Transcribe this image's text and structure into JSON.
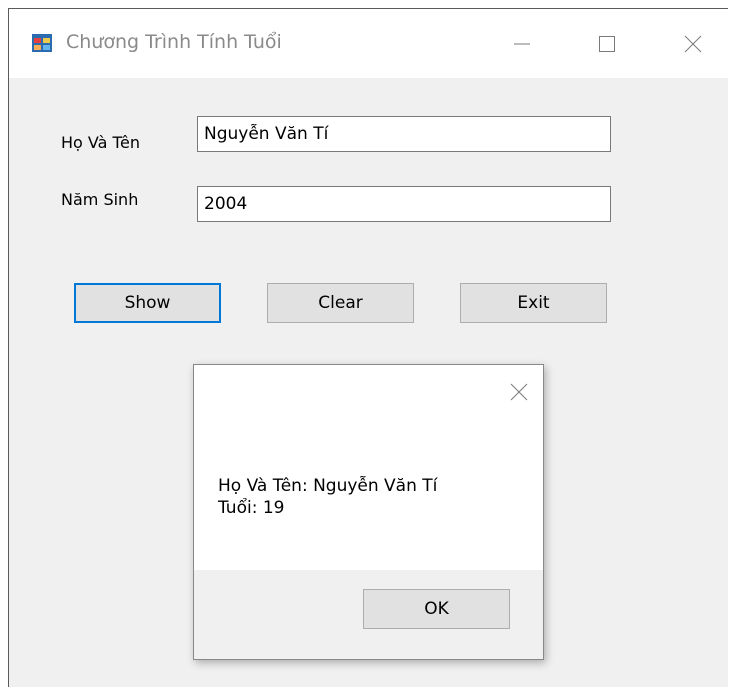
{
  "window": {
    "title": "Chương Trình Tính Tuổi",
    "icon": "windows-form-icon"
  },
  "titlebar_controls": {
    "minimize": "minimize-icon",
    "maximize": "maximize-icon",
    "close": "close-icon"
  },
  "form": {
    "name_label": "Họ Và Tên",
    "name_value": "Nguyễn Văn Tí",
    "year_label": "Năm Sinh",
    "year_value": "2004"
  },
  "buttons": {
    "show": "Show",
    "clear": "Clear",
    "exit": "Exit"
  },
  "message_box": {
    "line1": "Họ Và Tên: Nguyễn Văn Tí",
    "line2": "Tuổi: 19",
    "ok": "OK",
    "close": "close-icon"
  },
  "colors": {
    "focus_border": "#0078d7",
    "window_bg": "#f0f0f0"
  }
}
